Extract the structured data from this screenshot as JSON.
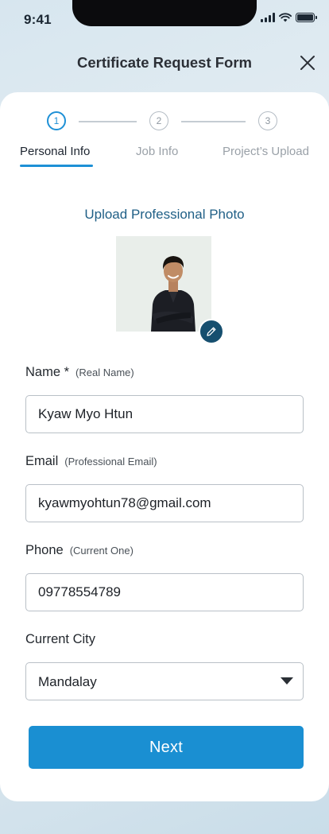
{
  "status_bar": {
    "time": "9:41",
    "icons": [
      "cellular-signal-icon",
      "wifi-icon",
      "battery-icon"
    ]
  },
  "header": {
    "title": "Certificate Request Form",
    "close_icon": "close-icon"
  },
  "stepper": {
    "steps": [
      {
        "number": "1",
        "label": "Personal Info",
        "active": true
      },
      {
        "number": "2",
        "label": "Job Info",
        "active": false
      },
      {
        "number": "3",
        "label": "Project’s Upload",
        "active": false
      }
    ]
  },
  "photo": {
    "label": "Upload Professional Photo",
    "edit_icon": "pencil-icon"
  },
  "form": {
    "name": {
      "label": "Name *",
      "hint": "(Real Name)",
      "value": "Kyaw Myo Htun"
    },
    "email": {
      "label": "Email",
      "hint": "(Professional Email)",
      "value": "kyawmyohtun78@gmail.com"
    },
    "phone": {
      "label": "Phone",
      "hint": "(Current One)",
      "value": "09778554789"
    },
    "city": {
      "label": "Current City",
      "value": "Mandalay"
    }
  },
  "actions": {
    "next_label": "Next"
  },
  "colors": {
    "accent": "#1a8fd2",
    "active_step": "#1e90d6",
    "photo_label": "#1f5f86",
    "edit_button": "#164f6f"
  }
}
